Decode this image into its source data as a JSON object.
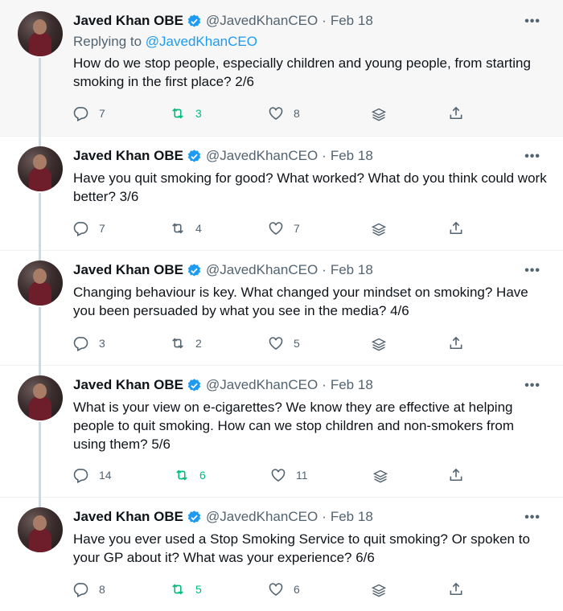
{
  "author": {
    "name": "Javed Khan OBE",
    "handle": "@JavedKhanCEO",
    "separator": "·"
  },
  "more_label": "•••",
  "replying_prefix": "Replying to ",
  "colors": {
    "retweet_active": "#00ba7c",
    "link": "#1d9bf0",
    "verified": "#1d9bf0",
    "muted": "#536471"
  },
  "tweets": [
    {
      "date": "Feb 18",
      "replying_to": "@JavedKhanCEO",
      "text": "How do we stop people, especially children and young people, from starting smoking in the first place? 2/6",
      "replies": "7",
      "retweets": "3",
      "likes": "8",
      "retweeted": true
    },
    {
      "date": "Feb 18",
      "text": "Have you quit smoking for good? What worked? What do you think could work better? 3/6",
      "replies": "7",
      "retweets": "4",
      "likes": "7",
      "retweeted": false
    },
    {
      "date": "Feb 18",
      "text": "Changing behaviour is key. What changed your mindset on smoking? Have you been persuaded by what you see in the media? 4/6",
      "replies": "3",
      "retweets": "2",
      "likes": "5",
      "retweeted": false
    },
    {
      "date": "Feb 18",
      "text": "What is your view on e-cigarettes? We know they are effective at helping people to quit smoking. How can we stop children and non-smokers from using them? 5/6",
      "replies": "14",
      "retweets": "6",
      "likes": "11",
      "retweeted": true
    },
    {
      "date": "Feb 18",
      "text": "Have you ever used a Stop Smoking Service to quit smoking? Or spoken to your GP about it? What was your experience? 6/6",
      "replies": "8",
      "retweets": "5",
      "likes": "6",
      "retweeted": true
    }
  ]
}
